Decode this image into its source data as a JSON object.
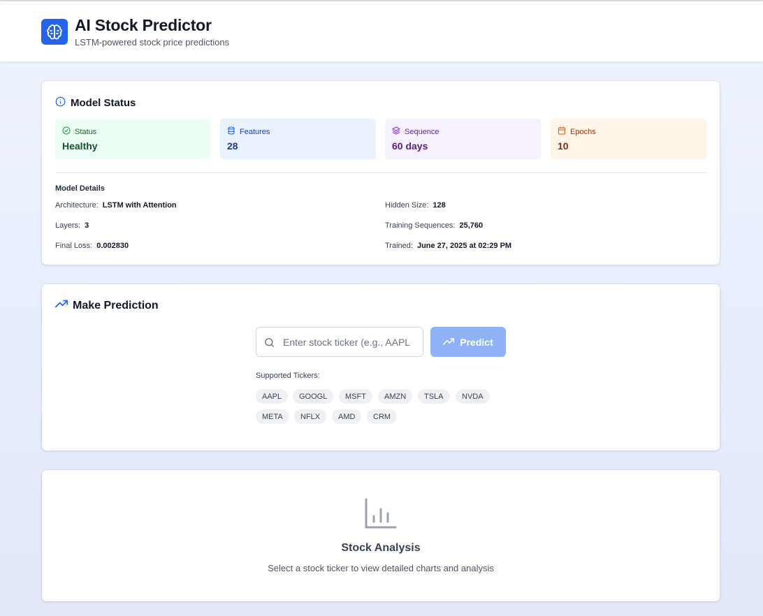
{
  "header": {
    "title": "AI Stock Predictor",
    "subtitle": "LSTM-powered stock price predictions",
    "logo_icon": "brain-icon"
  },
  "model_status": {
    "title": "Model Status",
    "icon": "info-circle-icon",
    "stats": [
      {
        "label": "Status",
        "value": "Healthy",
        "icon": "check-circle-icon",
        "bg": "#ecfdf3",
        "label_color": "#166534",
        "value_color": "#14532d"
      },
      {
        "label": "Features",
        "value": "28",
        "icon": "database-icon",
        "bg": "#eaf1fe",
        "label_color": "#1e40af",
        "value_color": "#1e3a8a"
      },
      {
        "label": "Sequence",
        "value": "60 days",
        "icon": "layers-icon",
        "bg": "#f7f1fe",
        "label_color": "#6b21a8",
        "value_color": "#581c87"
      },
      {
        "label": "Epochs",
        "value": "10",
        "icon": "calendar-icon",
        "bg": "#fff4e8",
        "label_color": "#9a3412",
        "value_color": "#7c2d12"
      }
    ],
    "details_heading": "Model Details",
    "details": [
      {
        "key": "Architecture:",
        "value": "LSTM with Attention"
      },
      {
        "key": "Hidden Size:",
        "value": "128"
      },
      {
        "key": "Layers:",
        "value": "3"
      },
      {
        "key": "Training Sequences:",
        "value": "25,760"
      },
      {
        "key": "Final Loss:",
        "value": "0.002830"
      },
      {
        "key": "Trained:",
        "value": "June 27, 2025 at 02:29 PM"
      }
    ]
  },
  "prediction": {
    "title": "Make Prediction",
    "icon": "trending-up-icon",
    "search_placeholder": "Enter stock ticker (e.g., AAPL",
    "search_value": "",
    "button_label": "Predict",
    "tickers_label": "Supported Tickers:",
    "tickers": [
      "AAPL",
      "GOOGL",
      "MSFT",
      "AMZN",
      "TSLA",
      "NVDA",
      "META",
      "NFLX",
      "AMD",
      "CRM"
    ]
  },
  "analysis": {
    "title": "Stock Analysis",
    "text": "Select a stock ticker to view detailed charts and analysis",
    "icon": "bar-chart-icon"
  },
  "colors": {
    "accent": "#2563eb",
    "predict_button": "#8fb2f7"
  }
}
